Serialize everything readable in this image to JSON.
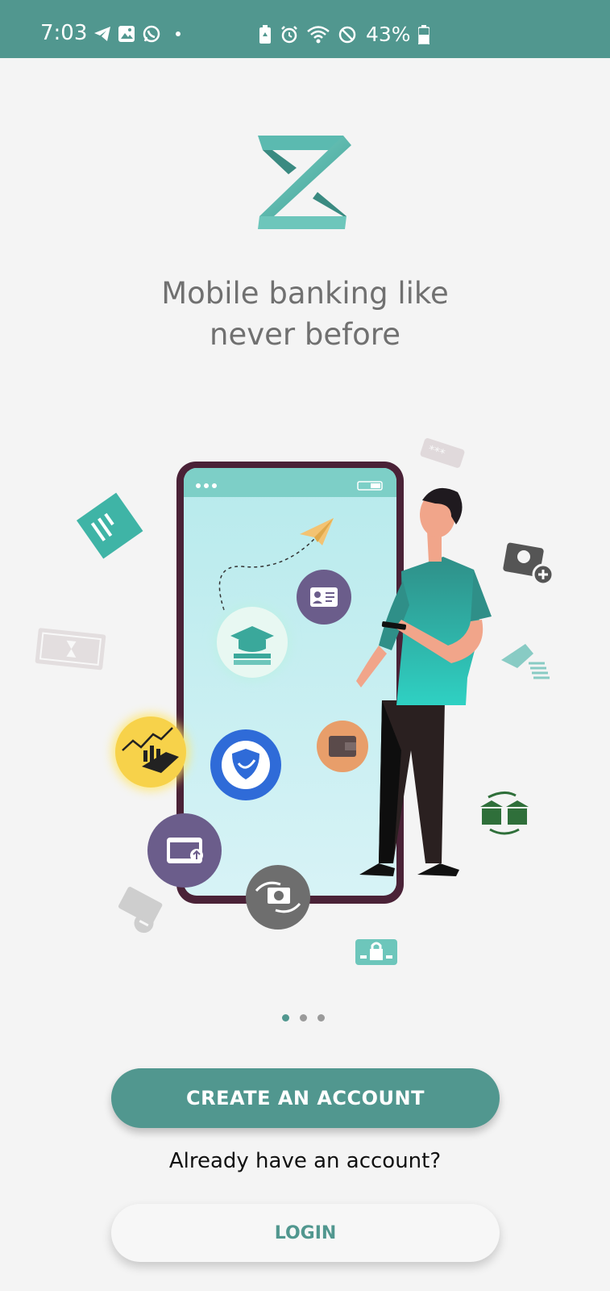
{
  "status_bar": {
    "time": "7:03",
    "battery": "43%",
    "left_icons": [
      "telegram-icon",
      "gallery-icon",
      "whatsapp-icon",
      "dot-icon"
    ],
    "right_icons": [
      "battery-saver-icon",
      "alarm-icon",
      "wifi-icon",
      "do-not-disturb-icon",
      "battery-icon"
    ]
  },
  "brand": {
    "logo": "z-logo",
    "accent_color": "#51978f"
  },
  "tagline": {
    "line1": "Mobile banking like",
    "line2": "never before"
  },
  "pager": {
    "current_page": 1,
    "total_pages": 3
  },
  "actions": {
    "create_label": "CREATE AN ACCOUNT",
    "already_text": "Already have an account?",
    "login_label": "LOGIN"
  }
}
